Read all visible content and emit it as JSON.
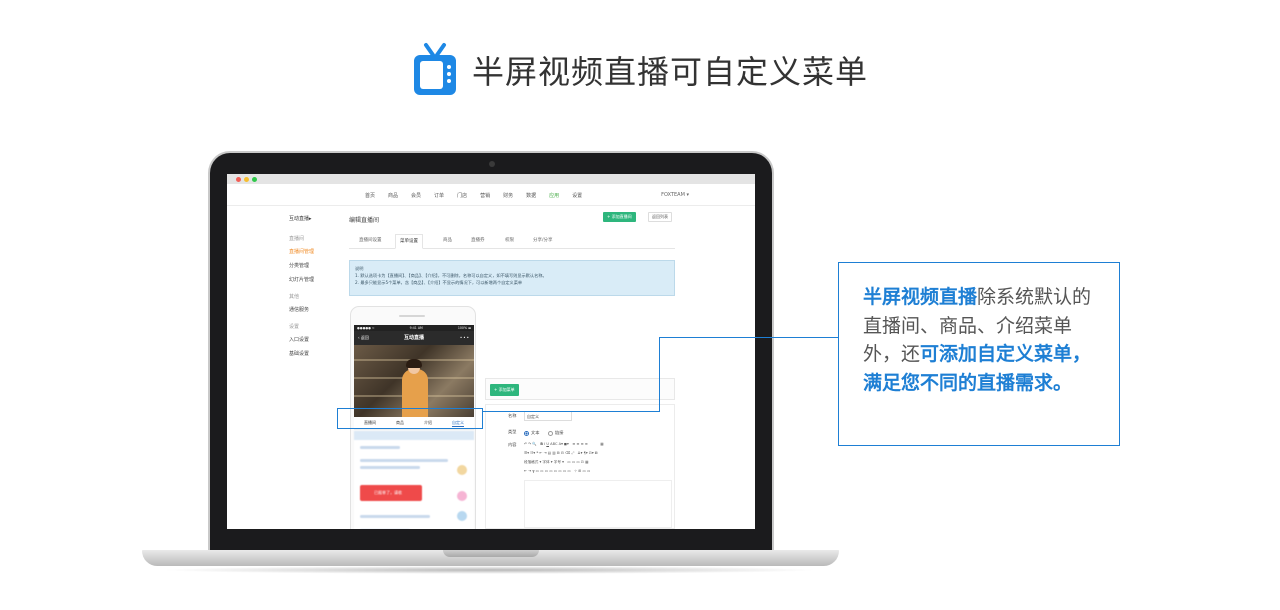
{
  "headline": {
    "title": "半屏视频直播可自定义菜单",
    "icon": "tv-icon",
    "icon_color": "#1e88e5"
  },
  "browser": {
    "traffic_lights": [
      "#f25d55",
      "#f6be2f",
      "#2fc84a"
    ]
  },
  "admin": {
    "nav": [
      "首页",
      "商品",
      "会员",
      "订单",
      "门店",
      "营销",
      "财务",
      "数据",
      "应用",
      "设置"
    ],
    "nav_active": "应用",
    "account": "FOXTEAM ▾",
    "sidebar": {
      "module": "互动直播▸",
      "sections": [
        {
          "title": "直播间",
          "items": [
            {
              "label": "直播间管理",
              "active": true
            },
            {
              "label": "分类管理",
              "active": false
            },
            {
              "label": "幻灯片管理",
              "active": false
            }
          ]
        },
        {
          "title": "其他",
          "items": [
            {
              "label": "通信服务",
              "active": false
            }
          ]
        },
        {
          "title": "设置",
          "items": [
            {
              "label": "入口设置",
              "active": false
            },
            {
              "label": "基础设置",
              "active": false
            }
          ]
        }
      ]
    },
    "page_title": "编辑直播间",
    "add_room_button": "+ 添加直播间",
    "back_button": "返回列表",
    "tabs": [
      "直播间设置",
      "菜单设置",
      "商品",
      "直播券",
      "权限",
      "分享/分享"
    ],
    "active_tab": "菜单设置",
    "notice": {
      "title": "说明",
      "line1": "1. 默认选项卡为【直播间】、【商品】、【介绍】，不可删除，名称可以自定义，如不填写则显示默认名称。",
      "line2": "2. 最多只能显示5个菜单，含【商品】、【介绍】不显示的情况下，可以新增两个自定义菜单"
    },
    "add_menu_button": "+ 添加菜单",
    "editor": {
      "name_label": "名称",
      "name_value": "自定义",
      "type_label": "类型",
      "type_options": [
        "文本",
        "链接"
      ],
      "content_label": "内容",
      "toolbar_row3": "段落格式 ▾  字体 ▾  字号 ▾"
    }
  },
  "phone": {
    "status_left": "●●●●● ≈",
    "status_time": "9:41 AM",
    "status_right": "100% ▬",
    "back_label": "返回",
    "header_title": "互动直播",
    "more": "•••",
    "tabs": [
      "直播间",
      "商品",
      "介绍",
      "自定义"
    ],
    "active_tab": "自定义",
    "chat_button": "已报单了，请收"
  },
  "callout": {
    "hl1": "半屏视频直播",
    "text1": "除系统默认的直播间、商品、介绍菜单外，还",
    "hl2": "可添加自定义菜单，满足您不同的直播需求。",
    "accent": "#1e7fd4"
  }
}
